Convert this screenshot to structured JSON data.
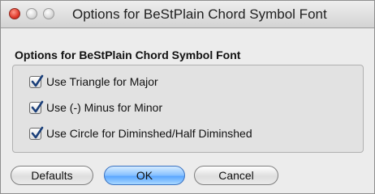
{
  "window": {
    "title": "Options for BeStPlain Chord Symbol Font"
  },
  "group": {
    "title": "Options for BeStPlain Chord Symbol Font",
    "options": [
      {
        "label": "Use Triangle for Major",
        "checked": true
      },
      {
        "label": "Use (-) Minus for Minor",
        "checked": true
      },
      {
        "label": "Use Circle for Diminshed/Half Diminshed",
        "checked": true
      }
    ]
  },
  "buttons": {
    "defaults": "Defaults",
    "ok": "OK",
    "cancel": "Cancel"
  },
  "colors": {
    "check": "#1a3f7a",
    "default_button": "#79b8ff"
  }
}
